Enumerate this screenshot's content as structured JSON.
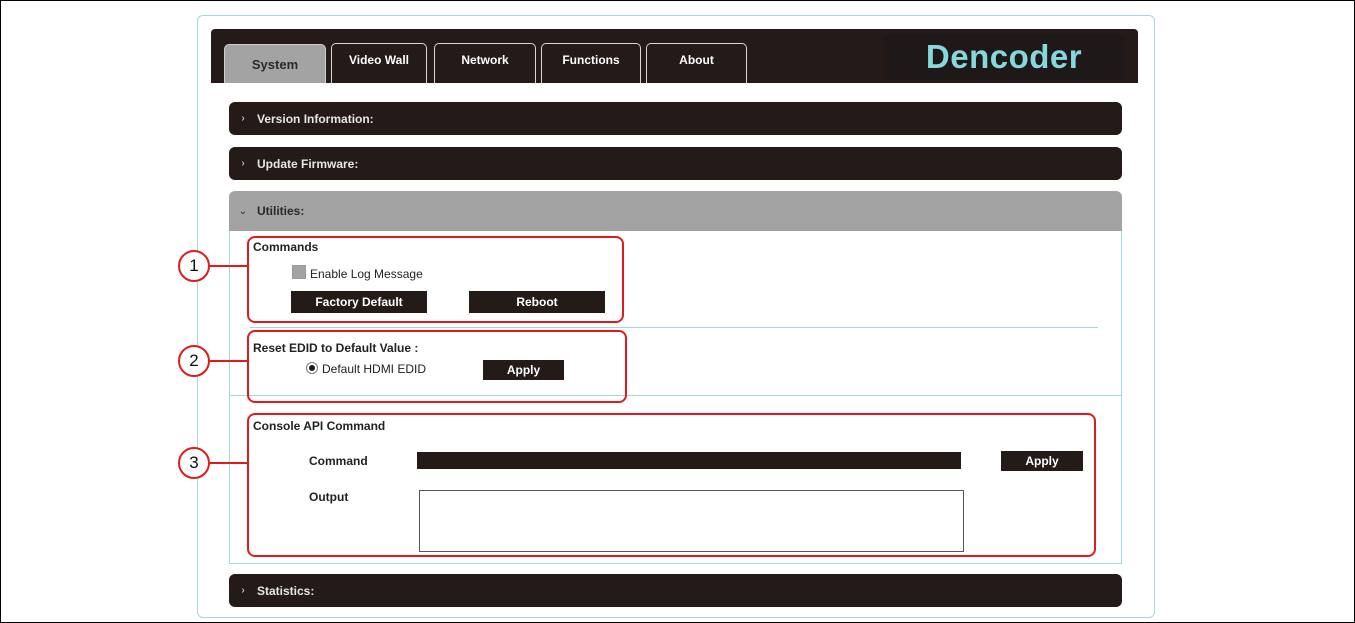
{
  "tabs": [
    "System",
    "Video Wall",
    "Network",
    "Functions",
    "About"
  ],
  "brand": "Dencoder",
  "sections": {
    "version": "Version Information:",
    "firmware": "Update Firmware:",
    "utilities": "Utilities:",
    "statistics": "Statistics:"
  },
  "commands": {
    "title": "Commands",
    "enable_log_label": "Enable Log Message",
    "factory_default_label": "Factory Default",
    "reboot_label": "Reboot"
  },
  "edid": {
    "title": "Reset EDID to Default Value :",
    "option_label": "Default HDMI EDID",
    "apply_label": "Apply"
  },
  "console": {
    "title": "Console API Command",
    "command_label": "Command",
    "output_label": "Output",
    "apply_label": "Apply"
  },
  "callouts": [
    "1",
    "2",
    "3"
  ],
  "icons": {
    "collapsed": "chevron-right-icon",
    "expanded": "chevron-down-icon"
  },
  "colors": {
    "dark": "#241a18",
    "active_gray": "#a3a3a3",
    "brand_text": "#86d8dc",
    "annotation_red": "#e01b1b",
    "panel_border": "#a9d6dc"
  }
}
